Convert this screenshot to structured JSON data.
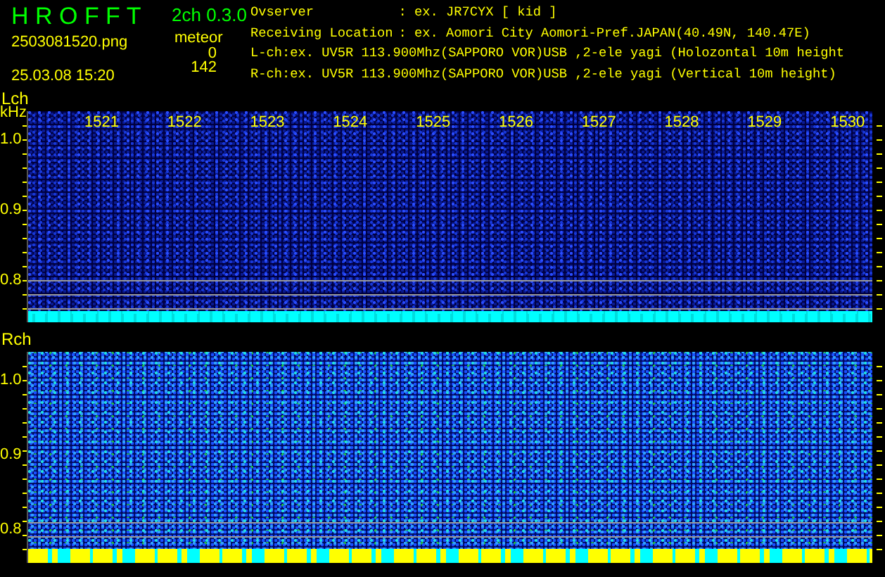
{
  "header": {
    "app_title": "H R O F F T",
    "version": "2ch 0.3.0",
    "filename": "2503081520.png",
    "datetime": "25.03.08 15:20",
    "mode_label": "meteor",
    "counts": [
      "0",
      "142"
    ],
    "info": [
      {
        "label": "Ovserver",
        "value": ": ex. JR7CYX [ kid ]"
      },
      {
        "label": "Receiving Location",
        "value": ": ex. Aomori City Aomori-Pref.JAPAN(40.49N, 140.47E)"
      },
      {
        "label": "L-ch:ex. UV5R 113.900Mhz(SAPPORO VOR)USB ,2-ele yagi (Holozontal 10m height"
      },
      {
        "label": "R-ch:ex. UV5R 113.900Mhz(SAPPORO VOR)USB ,2-ele yagi (Vertical 10m height)"
      }
    ]
  },
  "panels": [
    {
      "label": "Lch",
      "unit": "kHz",
      "kind": "quiet",
      "time_labels": [
        "1521",
        "1522",
        "1523",
        "1524",
        "1525",
        "1526",
        "1527",
        "1528",
        "1529",
        "1530"
      ],
      "y_labels": [
        "1.0",
        "0.9",
        "0.8"
      ]
    },
    {
      "label": "Rch",
      "kind": "busy",
      "y_labels": [
        "1.0",
        "0.9",
        "0.8"
      ]
    }
  ]
}
